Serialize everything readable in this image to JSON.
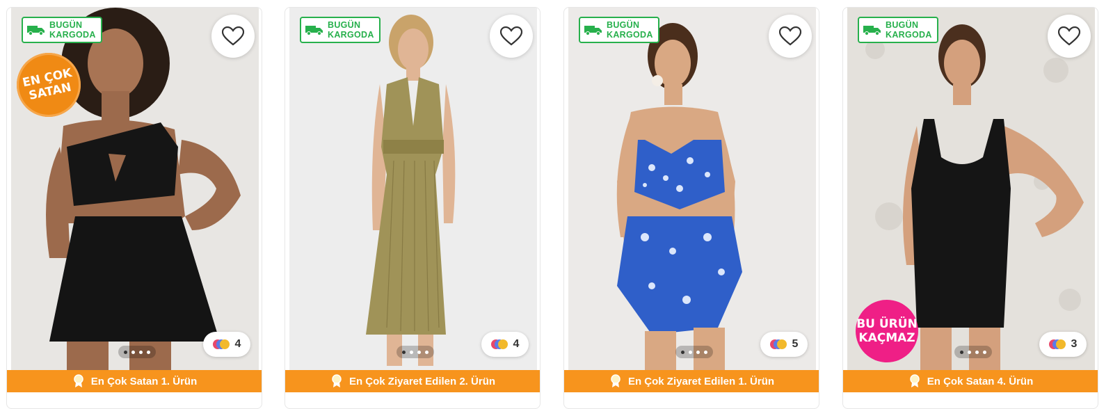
{
  "products": [
    {
      "cargo_badge": {
        "line1": "BUGÜN",
        "line2": "KARGODA"
      },
      "sticker": {
        "line1": "EN ÇOK",
        "line2": "SATAN",
        "color": "#f08a14"
      },
      "color_count": "4",
      "rank_label": "En Çok Satan 1. Ürün",
      "garment": "black one-shoulder cutout bikini top and skirt bottom"
    },
    {
      "cargo_badge": {
        "line1": "BUGÜN",
        "line2": "KARGODA"
      },
      "color_count": "4",
      "rank_label": "En Çok Ziyaret Edilen 2. Ürün",
      "garment": "olive halter neck maxi dress"
    },
    {
      "cargo_badge": {
        "line1": "BUGÜN",
        "line2": "KARGODA"
      },
      "color_count": "5",
      "rank_label": "En Çok Ziyaret Edilen 1. Ürün",
      "garment": "blue patterned bikini with pareo"
    },
    {
      "cargo_badge": {
        "line1": "BUGÜN",
        "line2": "KARGODA"
      },
      "sticker": {
        "line1": "BU ÜRÜN",
        "line2": "KAÇMAZ",
        "color": "#ef1f86"
      },
      "color_count": "3",
      "rank_label": "En Çok Satan 4. Ürün",
      "garment": "black short swimsuit"
    }
  ],
  "colors": {
    "cargo_green": "#27b04c",
    "rank_orange": "#f7941d",
    "heart_stroke": "#333333"
  }
}
